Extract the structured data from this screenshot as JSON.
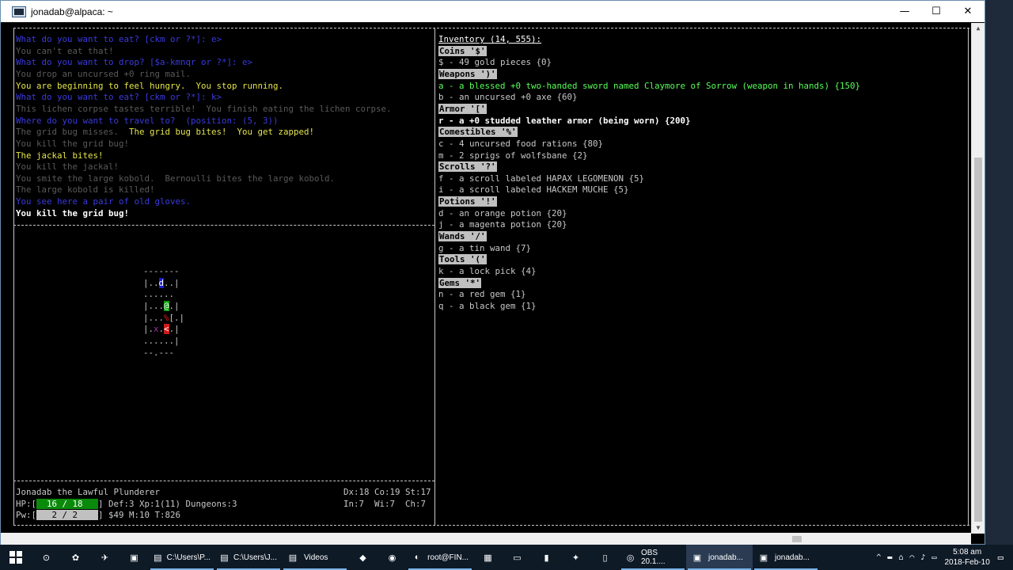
{
  "window": {
    "title": "jonadab@alpaca: ~",
    "minimize_glyph": "—",
    "maximize_glyph": "☐",
    "close_glyph": "✕"
  },
  "messages": [
    {
      "text": "What do you want to eat? [ckm or ?*]: e>",
      "style": "blue"
    },
    {
      "text": "You can't eat that!",
      "style": "dim"
    },
    {
      "text": "What do you want to drop? [$a-kmnqr or ?*]: e>",
      "style": "blue"
    },
    {
      "text": "You drop an uncursed +0 ring mail.",
      "style": "dim"
    },
    {
      "text": "You are beginning to feel hungry.  You stop running.",
      "style": "yellow"
    },
    {
      "text": "What do you want to eat? [ckm or ?*]: k>",
      "style": "blue"
    },
    {
      "text": "This lichen corpse tastes terrible!  You finish eating the lichen corpse.",
      "style": "dim"
    },
    {
      "text": "Where do you want to travel to?  (position: (5, 3))",
      "style": "blue"
    },
    {
      "text": "The grid bug misses.",
      "style": "dim",
      "extra": "  The grid bug bites!  You get zapped!",
      "extra_style": "yellow"
    },
    {
      "text": "You kill the grid bug!",
      "style": "dim"
    },
    {
      "text": "The jackal bites!",
      "style": "yellow"
    },
    {
      "text": "You kill the jackal!",
      "style": "dim"
    },
    {
      "text": "You smite the large kobold.  Bernoulli bites the large kobold.",
      "style": "dim"
    },
    {
      "text": "The large kobold is killed!",
      "style": "dim"
    },
    {
      "text": "You see here a pair of old gloves.",
      "style": "blue"
    },
    {
      "text": "You kill the grid bug!",
      "style": "white"
    }
  ],
  "inventory": {
    "title": "Inventory (14, 555):",
    "lines": [
      {
        "text": "Coins '$'",
        "style": "hdr"
      },
      {
        "text": "$ - 49 gold pieces {0}",
        "style": "plain"
      },
      {
        "text": "Weapons ')'",
        "style": "hdr"
      },
      {
        "text": "a - a blessed +0 two-handed sword named Claymore of Sorrow (weapon in hands) {150}",
        "style": "green"
      },
      {
        "text": "b - an uncursed +0 axe {60}",
        "style": "plain"
      },
      {
        "text": "Armor '['",
        "style": "hdr"
      },
      {
        "text": "r - a +0 studded leather armor (being worn) {200}",
        "style": "wht"
      },
      {
        "text": "Comestibles '%'",
        "style": "hdr"
      },
      {
        "text": "c - 4 uncursed food rations {80}",
        "style": "plain"
      },
      {
        "text": "m - 2 sprigs of wolfsbane {2}",
        "style": "plain"
      },
      {
        "text": "Scrolls '?'",
        "style": "hdr"
      },
      {
        "text": "f - a scroll labeled HAPAX LEGOMENON {5}",
        "style": "plain"
      },
      {
        "text": "i - a scroll labeled HACKEM MUCHE {5}",
        "style": "plain"
      },
      {
        "text": "Potions '!'",
        "style": "hdr"
      },
      {
        "text": "d - an orange potion {20}",
        "style": "plain"
      },
      {
        "text": "j - a magenta potion {20}",
        "style": "plain"
      },
      {
        "text": "Wands '/'",
        "style": "hdr"
      },
      {
        "text": "g - a tin wand {7}",
        "style": "plain"
      },
      {
        "text": "Tools '('",
        "style": "hdr"
      },
      {
        "text": "k - a lock pick {4}",
        "style": "plain"
      },
      {
        "text": "Gems '*'",
        "style": "hdr"
      },
      {
        "text": "n - a red gem {1}",
        "style": "plain"
      },
      {
        "text": "q - a black gem {1}",
        "style": "plain"
      }
    ]
  },
  "map_rows": [
    [
      {
        "t": "-------"
      }
    ],
    [
      {
        "t": "|.."
      },
      {
        "t": "d",
        "c": "#ffffff",
        "bg": "#1a1acc"
      },
      {
        "t": "..|"
      }
    ],
    [
      {
        "t": "......"
      }
    ],
    [
      {
        "t": "|..."
      },
      {
        "t": "@",
        "c": "#ffffff",
        "bg": "#0a9a0a"
      },
      {
        "t": ".|"
      }
    ],
    [
      {
        "t": "|..."
      },
      {
        "t": "%",
        "c": "#cc2222"
      },
      {
        "t": "[.|"
      }
    ],
    [
      {
        "t": "|."
      },
      {
        "t": "x",
        "c": "#aa2aaa"
      },
      {
        "t": "."
      },
      {
        "t": "<",
        "c": "#ffffff",
        "bg": "#cc1a1a"
      },
      {
        "t": ".|"
      }
    ],
    [
      {
        "t": "......|"
      }
    ],
    [
      {
        "t": "--.---"
      }
    ]
  ],
  "status": {
    "name_line": "Jonadab the Lawful Plunderer",
    "stats_right_1": "Dx:18 Co:19 St:17",
    "hp_label": "HP:[",
    "hp_value": "  16 / 18   ",
    "hp_fraction": 1.0,
    "hp_rest": "] Def:3 Xp:1(11) Dungeons:3",
    "stats_right_2": "In:7  Wi:7  Ch:7",
    "pw_label": "Pw:[",
    "pw_value": "   2 / 2    ",
    "pw_rest": "] $49 M:10 T:826"
  },
  "taskbar": {
    "apps": [
      {
        "label": "",
        "icon": "⊙",
        "name": "cortana-icon"
      },
      {
        "label": "",
        "icon": "✿",
        "name": "app-icon-1"
      },
      {
        "label": "",
        "icon": "✈",
        "name": "app-icon-2"
      },
      {
        "label": "",
        "icon": "▣",
        "name": "app-icon-3"
      },
      {
        "label": "C:\\Users\\P...",
        "icon": "▤",
        "name": "folder-icon"
      },
      {
        "label": "C:\\Users\\J...",
        "icon": "▤",
        "name": "folder-icon"
      },
      {
        "label": "Videos",
        "icon": "▤",
        "name": "folder-icon"
      },
      {
        "label": "",
        "icon": "◆",
        "name": "app-icon-4"
      },
      {
        "label": "",
        "icon": "◉",
        "name": "app-icon-5"
      },
      {
        "label": "root@FIN...",
        "icon": "◐",
        "name": "ubuntu-icon"
      },
      {
        "label": "",
        "icon": "▦",
        "name": "calculator-icon"
      },
      {
        "label": "",
        "icon": "▭",
        "name": "app-icon-6"
      },
      {
        "label": "",
        "icon": "▮",
        "name": "cmd-icon"
      },
      {
        "label": "",
        "icon": "✦",
        "name": "app-icon-7"
      },
      {
        "label": "",
        "icon": "▯",
        "name": "notepad-icon"
      },
      {
        "label": "OBS 20.1....",
        "icon": "◎",
        "name": "obs-icon"
      },
      {
        "label": "jonadab...",
        "icon": "▣",
        "name": "terminal-icon"
      },
      {
        "label": "jonadab...",
        "icon": "▣",
        "name": "terminal-icon"
      }
    ],
    "tray_icons": [
      "^",
      "▬",
      "⌂",
      "◠",
      "♪",
      "▭"
    ],
    "time": "5:08 am",
    "date": "2018-Feb-10",
    "notification_icon": "▭"
  }
}
